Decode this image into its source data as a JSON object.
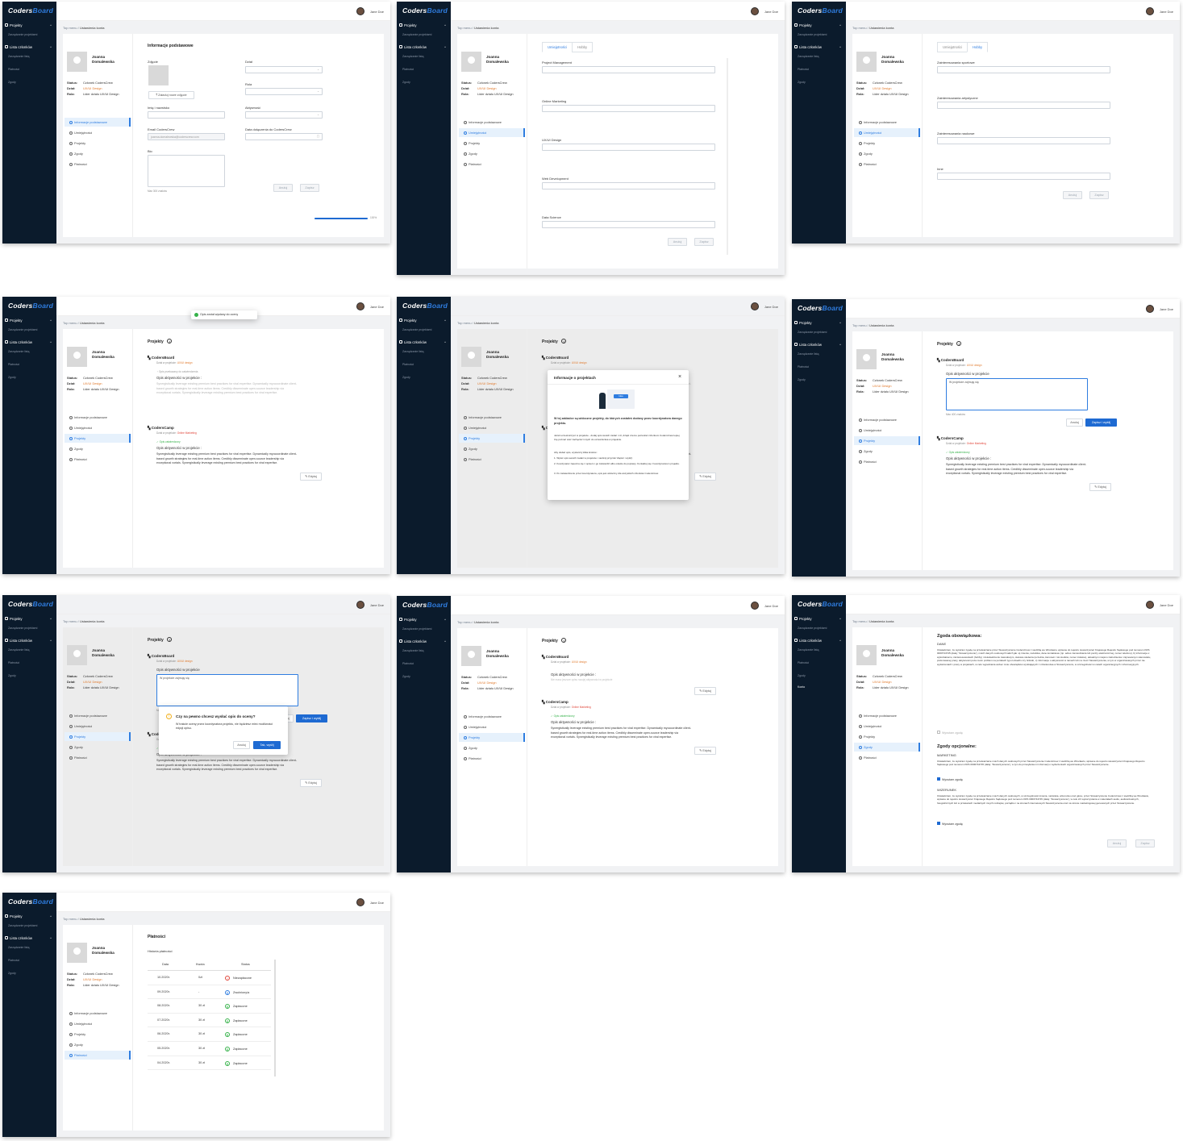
{
  "app": {
    "logo_a": "Coders",
    "logo_b": "Board"
  },
  "nav": {
    "projects": "Projekty",
    "manage_projects": "Zarządzanie projektami",
    "members_list": "Lista członków",
    "manage_teams": "Zarządzanie listą",
    "payments": "Płatności",
    "consents": "Zgody",
    "account": "Konto"
  },
  "header": {
    "username": "Jane Doe"
  },
  "breadcrumb": {
    "root": "Top menu",
    "sep": "/",
    "current": "Ustawienia konta"
  },
  "profile": {
    "name_line1": "Joanna",
    "name_line2": "Domalewska",
    "status_label": "Status:",
    "status_value": "Członek CodersCrew",
    "dept_label": "Dział:",
    "dept_value": "UX/UI Design",
    "role_label": "Rola:",
    "role_value": "Lider działu UX/UI Design"
  },
  "profile_menu": {
    "basic": "Informacje podstawowe",
    "skills": "Umiejętności",
    "projects": "Projekty",
    "consents": "Zgody",
    "payments": "Płatności"
  },
  "basic_info": {
    "title": "Informacje podstawowe",
    "photo_label": "Zdjęcie",
    "upload_btn": "Załaduj nowe zdjęcie",
    "name_label": "Imię i nazwisko",
    "email_label": "Email CodersCrew",
    "email_value": "joanna.domalewska@coderscrew.com",
    "bio_label": "Bio",
    "bio_hint": "Max 300 znaków",
    "dept_label": "Dział",
    "role_label": "Rola",
    "activity_label": "Aktywność",
    "join_date_label": "Data dołączenia do CodersCrew",
    "cancel": "Anuluj",
    "save": "Zapisz",
    "progress_pct": 100,
    "progress_label": "100%"
  },
  "skills": {
    "tab_skills": "Umiejętności",
    "tab_hobby": "Hobby",
    "items": [
      "Project Management",
      "Online Marketing",
      "UX/UI Design",
      "Web Development",
      "Data Science"
    ],
    "hobby_items": [
      "Zainteresowania sportowe",
      "Zainteresowania artystyczne",
      "Zainteresowania naukowe",
      "Inne"
    ]
  },
  "projects": {
    "title": "Projekty",
    "info_icon": "i",
    "toast": "Opis został wysłany do oceny",
    "p1_name": "CodersBoard",
    "p1_dept_prefix": "Dział w projekcie:",
    "p1_dept": "UX/UI design",
    "p1_status": "Opis przekazany do zatwierdzenia",
    "desc_title": "Opis aktywności w projekcie :",
    "p1_desc": "Synergistically leverage existing premium best practices for viral expertise. Dynamically myocoordinate client-based growth strategies for real-time action items. Credibly disseminate open-source leadership via exceptional vortals. Synergistically leverage existing premium best practices for viral expertise.",
    "p2_name": "CodersCamp",
    "p2_dept": "Online Marketing",
    "p2_status": "Opis zatwierdzony",
    "p2_desc": "Synergistically leverage existing premium best practices for viral expertise. Dynamically myocoordinate client-based growth strategies for real-time action items. Credibly disseminate open-source leadership via exceptional vortals. Synergistically leverage existing premium best practices for viral expertise.",
    "edit": "Edytuj",
    "desc_title2": "Opis aktywności w projekcie",
    "desc_placeholder": "W projekcie zajmuję się",
    "max_chars": "Max 400 znaków",
    "cancel": "Anuluj",
    "save_send": "Zapisz i wyślij",
    "empty_hint": "Nie masz jeszcze opisu swojej aktywności w projekcie"
  },
  "info_modal": {
    "title": "Informacje o projektach",
    "close": "×",
    "illustration_label": "Idea",
    "lead": "W tej zakładce są widoczne projekty, do których zostałeś dodany przez koordynatora danego projektu.",
    "p1": "Jeżeli uczestniczysz w projekcie - dodaj opis swoich zadań i ról, dzięki czemu pozwolisz członkom CodersCrew lepiej Cię poznać oraz zachęcisz innych do uczestnictwa w projekcie.",
    "p2": "Aby dodać opis, wystarczy kilka kroków :",
    "s1": "1. Wpisz opis swoich zadań w projekcie i naciśnij przycisk 'Zapisz i wyślij'.",
    "s2": "2. Koordynator zapozna się z opisem i go zatwierdzi albo odeśle do poprawy. Kontaktuj się z koordynatorem projektu.",
    "s3": "3. Po zatwierdzeniu przez koordynatora, opis jest widoczny dla wszystkich członków CodersCrew."
  },
  "confirm_modal": {
    "title": "Czy na pewno chcesz wysłać opis do oceny?",
    "body": "W trakcie oceny przez koordynatora projektu, nie będziesz mieć możliwości edycji opisu.",
    "cancel": "Anuluj",
    "ok": "Tak, wyślij"
  },
  "consents": {
    "required_title": "Zgoda obowiązkowa:",
    "data_heading": "DANE",
    "data_text": "Oświadczam, że wyrażam zgodę na przetwarzanie przez Stowarzyszenie CodersCrew z siedzibą we Wrocławiu, wpisane do rejestru stowarzyszeń Krajowego Rejestru Sądowego pod numerem KRS 0000744745 (dalej: 'Stowarzyszenie'), moich danych osobowych takich jak: a) imienia, nazwiska, dane kontaktowe (np. adres zamieszkania lub poczty elektronicznej, numer telefonu), b) informacje o: wykształceniu, zainteresowaniach (hobby) i doświadczeniu zawodowym, statusie studenta (uczelnia, kierunek i rok studiów, numer indeksu), aktualnym miejscu zatrudnienia i zajmowanym stanowisku, preferowanej pracy, aktywności poza moim profilem na portalach typu LinkedIn czy GitHub, c) informacje o aktywności w ramach lub na rzecz Stowarzyszenia, w tym w organizowanych przez nie wydarzeniach i pracy w projektach, w celu wypełniania wobec mnie obowiązków wynikających z członkostwa w Stowarzyszeniu, w szczególności w celach organizacyjnych i informacyjnych.",
    "data_check": "Wyrażam zgodę",
    "optional_title": "Zgody opcjonalne:",
    "marketing_heading": "MARKETING",
    "marketing_text": "Oświadczam, że wyrażam zgodę na przetwarzanie moich danych osobowych przez Stowarzyszenie CodersCrew z siedzibą we Wrocławiu, wpisane do rejestru stowarzyszeń Krajowego Rejestru Sądowego pod numerem KRS 0000744745 (dalej: 'Stowarzyszenie'), w tym do przesyłania mi informacji o wydarzeniach organizowanych przez Stowarzyszenie.",
    "marketing_check": "Wyrażam zgodę",
    "image_heading": "WIZERUNEK",
    "image_text": "Oświadczam, że wyrażam zgodę na przetwarzanie moich danych osobowych, w szczególności imienia, nazwiska, wizerunku oraz głosu, przez Stowarzyszenie CodersCrew z siedzibą we Wrocławiu, wpisane do rejestru stowarzyszeń Krajowego Rejestru Sądowego pod numerem KRS 0000744745 (dalej: 'Stowarzyszenie'), w celu ich wykorzystania w materiałach audio, audiowizualnych, fotograficznych lub w przekazach medialnych innych rodzajów, porządku i na stronach internetowych Stowarzyszenia oraz na stronie marketingowej genowanych przez Stowarzyszenie.",
    "image_check": "Wyrażam zgodę",
    "cancel": "Anuluj",
    "save": "Zapisz"
  },
  "payments": {
    "title": "Płatności",
    "history": "Historia płatności",
    "col_date": "Data",
    "col_amount": "Kwota",
    "col_status": "Status",
    "rows": [
      {
        "date": "10.2020r.",
        "amount": "0zł",
        "status": "Niezapłacone",
        "kind": "unpaid"
      },
      {
        "date": "09.2020r.",
        "amount": "-",
        "status": "Zwolniony/a",
        "kind": "exempt"
      },
      {
        "date": "08.2020r.",
        "amount": "30 zł",
        "status": "Zapłacone",
        "kind": "paid"
      },
      {
        "date": "07.2020r.",
        "amount": "30 zł",
        "status": "Zapłacone",
        "kind": "paid"
      },
      {
        "date": "06.2020r.",
        "amount": "30 zł",
        "status": "Zapłacone",
        "kind": "paid"
      },
      {
        "date": "05.2020r.",
        "amount": "30 zł",
        "status": "Zapłacone",
        "kind": "paid"
      },
      {
        "date": "04.2020r.",
        "amount": "30 zł",
        "status": "Zapłacone",
        "kind": "paid"
      }
    ]
  },
  "colors": {
    "brand": "#2f7de0",
    "sidebar": "#0b1b2c",
    "orange": "#e07a2d",
    "green": "#36b24a",
    "red": "#e0463a",
    "primary_btn": "#1e6ad2"
  }
}
